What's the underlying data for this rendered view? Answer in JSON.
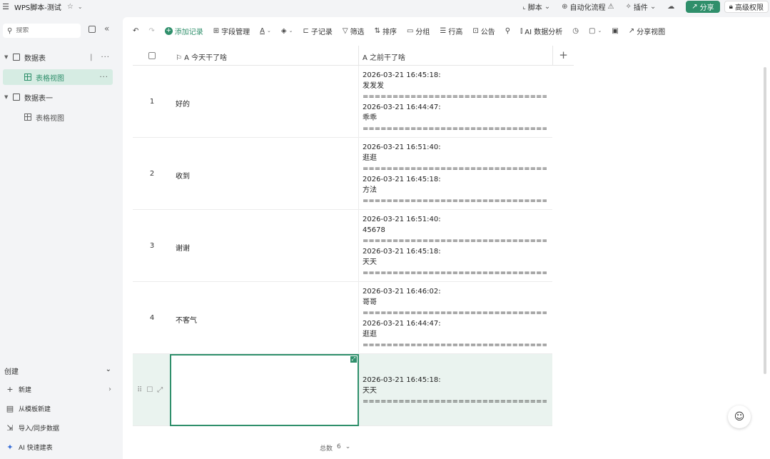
{
  "titlebar": {
    "app_title": "WPS脚本-测试",
    "right": [
      {
        "icon": "script-icon",
        "label": "脚本"
      },
      {
        "icon": "flow-icon",
        "label": "自动化流程"
      },
      {
        "icon": "plugin-icon",
        "label": "插件"
      }
    ],
    "share_label": "分享",
    "perm_label": "高级权限"
  },
  "sidebar": {
    "search_placeholder": "搜索",
    "tables": [
      {
        "label": "数据表",
        "views": [
          {
            "label": "表格视图",
            "active": true
          }
        ]
      },
      {
        "label": "数据表一",
        "views": [
          {
            "label": "表格视图",
            "active": false
          }
        ]
      }
    ],
    "create_label": "创建",
    "create_items": [
      {
        "icon": "plus-icon",
        "label": "新建"
      },
      {
        "icon": "template-icon",
        "label": "从模板新建"
      },
      {
        "icon": "import-icon",
        "label": "导入/同步数据"
      },
      {
        "icon": "ai-icon",
        "label": "AI 快速建表"
      }
    ]
  },
  "toolbar": {
    "add_record": "添加记录",
    "field_manage": "字段管理",
    "sub_record": "子记录",
    "filter": "筛选",
    "sort": "排序",
    "group": "分组",
    "row_height": "行高",
    "announcement": "公告",
    "search_trunc": "Q 互",
    "ai_analysis": "AI 数据分析",
    "share_view": "分享视图"
  },
  "grid": {
    "col1_header": "今天干了啥",
    "col2_header": "之前干了啥",
    "rows": [
      {
        "num": "1",
        "today": "好的",
        "before": "2026-03-21 16:45:18:\n发发发\n==================================\n2026-03-21 16:44:47:\n乖乖\n=================================="
      },
      {
        "num": "2",
        "today": "收到",
        "before": "2026-03-21 16:51:40:\n逛逛\n==================================\n2026-03-21 16:45:18:\n方法\n=================================="
      },
      {
        "num": "3",
        "today": "谢谢",
        "before": "2026-03-21 16:51:40:\n45678\n==================================\n2026-03-21 16:45:18:\n天天\n================================== 20..."
      },
      {
        "num": "4",
        "today": "不客气",
        "before": "2026-03-21 16:46:02:\n哥哥\n==================================\n2026-03-21 16:44:47:\n逛逛\n=================================="
      },
      {
        "num": "",
        "today": "",
        "before": "\n2026-03-21 16:45:18:\n天天\n=================================="
      }
    ]
  },
  "footer": {
    "total_label": "总数",
    "total_value": "6"
  }
}
